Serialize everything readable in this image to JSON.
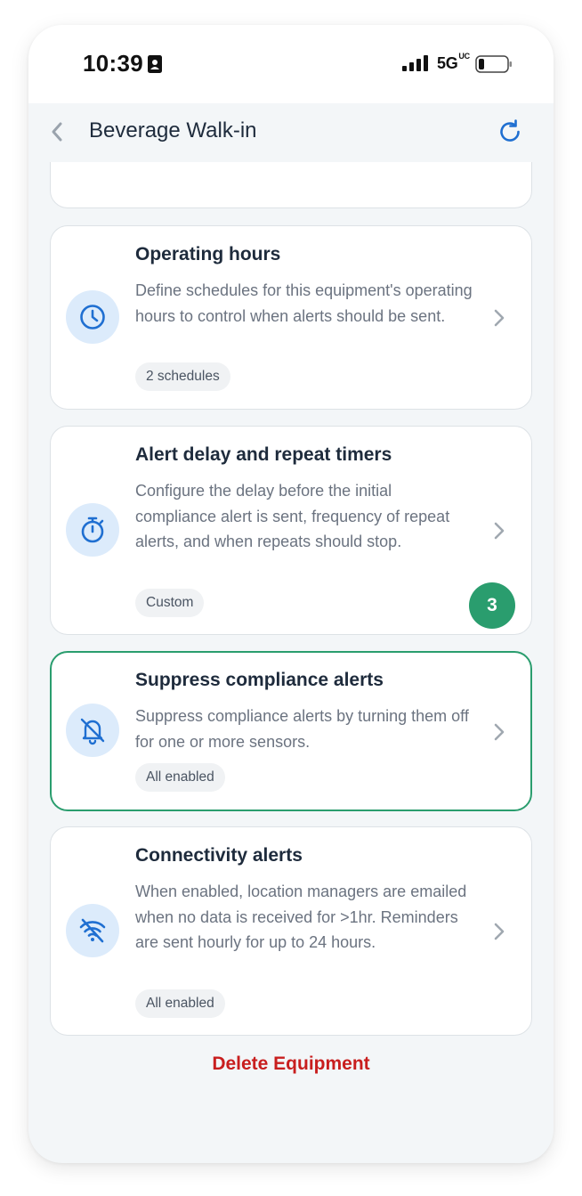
{
  "status_bar": {
    "time": "10:39",
    "network": "5G",
    "network_suffix": "UC"
  },
  "header": {
    "title": "Beverage Walk-in",
    "back_icon": "chevron-left-icon",
    "refresh_icon": "refresh-icon"
  },
  "cards": [
    {
      "title": "Operating hours",
      "description": "Define schedules for this equipment's operating hours to control when alerts should be sent.",
      "tag": "2 schedules",
      "icon": "clock-icon"
    },
    {
      "title": "Alert delay and repeat timers",
      "description": "Configure the delay before the initial compliance alert is sent, frequency of repeat alerts, and when repeats should stop.",
      "tag": "Custom",
      "icon": "stopwatch-icon"
    },
    {
      "title": "Suppress compliance alerts",
      "description": "Suppress compliance alerts by turning them off for one or more sensors.",
      "tag": "All enabled",
      "icon": "bell-off-icon",
      "highlighted": true
    },
    {
      "title": "Connectivity alerts",
      "description": "When enabled, location managers are emailed when no data is received for >1hr. Reminders are sent hourly for up to 24 hours.",
      "tag": "All enabled",
      "icon": "wifi-off-icon"
    }
  ],
  "step_badge": "3",
  "delete_label": "Delete Equipment",
  "colors": {
    "accent_blue": "#1f6fd1",
    "icon_bg": "#dcebfb",
    "highlight_green": "#2a9d6e",
    "danger_red": "#c81e1e"
  }
}
